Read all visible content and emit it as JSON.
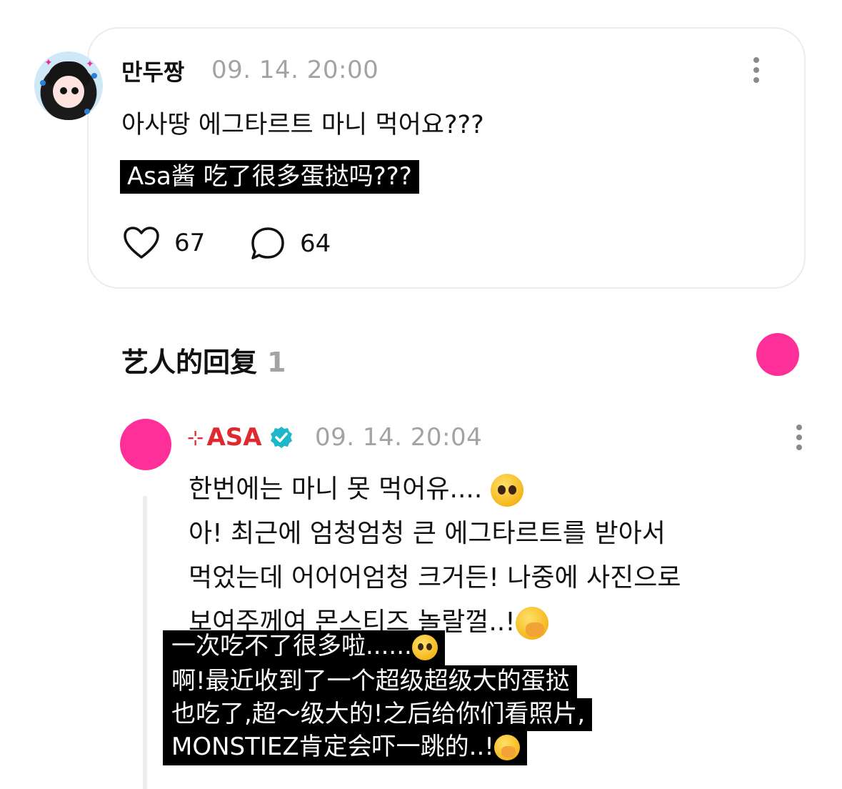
{
  "fan_comment": {
    "username": "만두짱",
    "timestamp": "09. 14. 20:00",
    "text": "아사땅 에그타르트 마니 먹어요???",
    "translation": "Asa酱 吃了很多蛋挞吗???",
    "likes": "67",
    "comments": "64"
  },
  "artist_section": {
    "title": "艺人的回复",
    "count": "1"
  },
  "artist_reply": {
    "name_prefix": "⊹",
    "name": "ASA",
    "timestamp": "09. 14. 20:04",
    "lines": [
      "한번에는 마니 못 먹어유....",
      "아! 최근에 엄청엄청 큰 에그타르트를 받아서",
      "먹었는데 어어어엄청 크거든! 나중에 사진으로",
      "보여주께여 몬스티즈 놀랄껄..!"
    ],
    "translation_lines": [
      "一次吃不了很多啦......",
      "啊!最近收到了一个超级超级大的蛋挞",
      "也吃了,超～级大的!之后给你们看照片,",
      "MONSTIEZ肯定会吓一跳的..!"
    ]
  },
  "colors": {
    "accent_pink": "#ff2f9a",
    "artist_red": "#e0282f",
    "verified_teal": "#1fb8c9",
    "muted_gray": "#a3a3a3"
  },
  "icons": [
    "heart-icon",
    "comment-bubble-icon",
    "more-vertical-icon",
    "verified-badge-icon",
    "pleading-face-emoji",
    "hand-over-mouth-emoji"
  ]
}
